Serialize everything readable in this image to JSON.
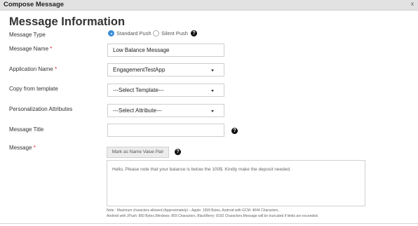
{
  "window": {
    "title": "Compose Message",
    "close_label": "x"
  },
  "section": {
    "title": "Message Information"
  },
  "message_type": {
    "label": "Message Type",
    "options": [
      {
        "label": "Standard Push",
        "selected": true
      },
      {
        "label": "Silent Push",
        "selected": false
      }
    ],
    "help": "?"
  },
  "message_name": {
    "label": "Message Name",
    "required": "*",
    "value": "Low Balance Message"
  },
  "application_name": {
    "label": "Application Name",
    "required": "*",
    "value": "EngagementTestApp"
  },
  "copy_template": {
    "label": "Copy from template",
    "value": "---Select Template---"
  },
  "personalization": {
    "label": "Personalization Attributes",
    "value": "---Select Attribute---"
  },
  "message_title": {
    "label": "Message Title",
    "value": "",
    "help": "?"
  },
  "message": {
    "label": "Message",
    "required": "*",
    "mark_button": "Mark as Name Value Pair",
    "help": "?",
    "value": "Hello, Please note that your balance is below the 100$. Kindly make the deposit needed."
  },
  "note": {
    "line1": "Note : Maximum characters allowed (Approximately) – Apple: 1999 Bytes, Android with GCM: 4044 Characters,",
    "line2": "Android with JPush: 850 Bytes,Windows: 859 Characters, BlackBerry: 8192 Characters.Message will be truncated if limits are exceeded."
  }
}
